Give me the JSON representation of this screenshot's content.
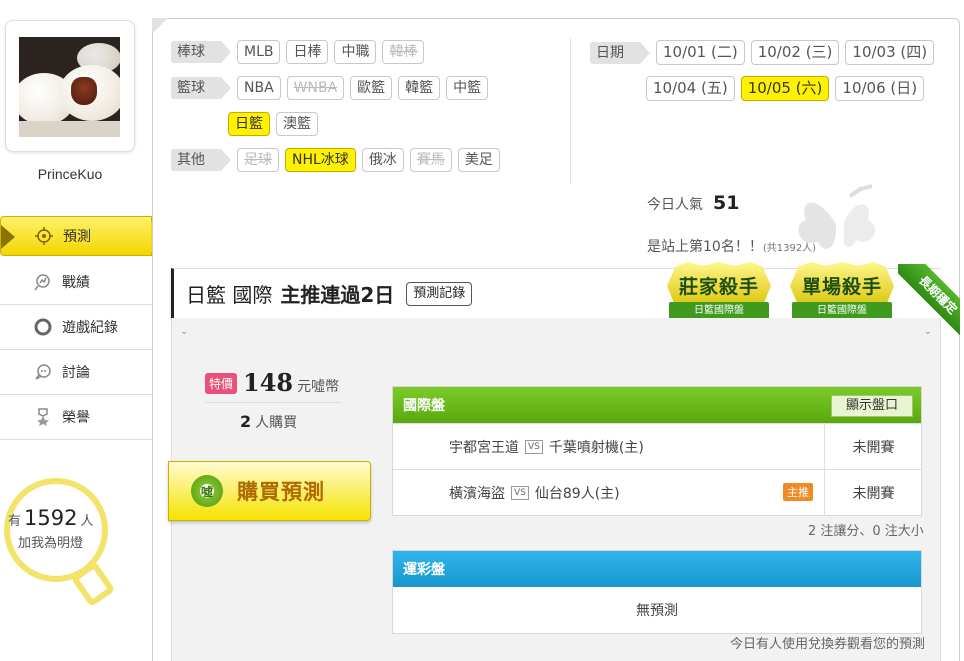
{
  "user": {
    "name": "PrinceKuo"
  },
  "nav": [
    {
      "label": "預測",
      "icon": "crosshair-icon",
      "active": true
    },
    {
      "label": "戰績",
      "icon": "chart-icon"
    },
    {
      "label": "遊戲紀錄",
      "icon": "circle-icon"
    },
    {
      "label": "討論",
      "icon": "chat-icon"
    },
    {
      "label": "榮譽",
      "icon": "medal-icon"
    }
  ],
  "fans": {
    "prefix": "有",
    "count": "1592",
    "suffix": "人",
    "line2": "加我為明燈"
  },
  "filters": {
    "baseball": {
      "label": "棒球",
      "tags": [
        "MLB",
        "日棒",
        "中職",
        "韓棒"
      ]
    },
    "basketball": {
      "label": "籃球",
      "tags": [
        "NBA",
        "WNBA",
        "歐籃",
        "韓籃",
        "中籃",
        "日籃",
        "澳籃"
      ]
    },
    "other": {
      "label": "其他",
      "tags": [
        "足球",
        "NHL冰球",
        "俄冰",
        "賽馬",
        "美足"
      ]
    }
  },
  "dates": {
    "label": "日期",
    "items": [
      "10/01 (二)",
      "10/02 (三)",
      "10/03 (四)",
      "10/04 (五)",
      "10/05 (六)",
      "10/06 (日)"
    ],
    "selected": "10/05 (六)"
  },
  "popularity": {
    "label": "今日人氣",
    "value": "51"
  },
  "rank": {
    "text": "是站上第10名！！",
    "sub": "(共1392人)"
  },
  "title": {
    "league": "日籃 國際",
    "headline": "主推連過2日",
    "record_btn": "預測記錄"
  },
  "badges": [
    {
      "title": "莊家殺手",
      "sub": "日籃國際盤"
    },
    {
      "title": "單場殺手",
      "sub": "日籃國際盤"
    }
  ],
  "ribbon": "長期穩定",
  "price": {
    "tag": "特價",
    "amount": "148",
    "unit": "元噓幣",
    "buyers": "2",
    "buyers_unit": "人購買"
  },
  "buy_button": {
    "coin": "噓",
    "label": "購買預測"
  },
  "intl": {
    "header": "國際盤",
    "show_btn": "顯示盤口",
    "rows": [
      {
        "away": "宇都宮王道",
        "vs": "VS",
        "home": "千葉噴射機(主)",
        "status": "未開賽",
        "tag": ""
      },
      {
        "away": "橫濱海盜",
        "vs": "VS",
        "home": "仙台89人(主)",
        "status": "未開賽",
        "tag": "主推"
      }
    ],
    "note": "2 注讓分、0 注大小"
  },
  "combo": {
    "header": "運彩盤",
    "empty": "無預測"
  },
  "footnote": "今日有人使用兌換券觀看您的預測"
}
